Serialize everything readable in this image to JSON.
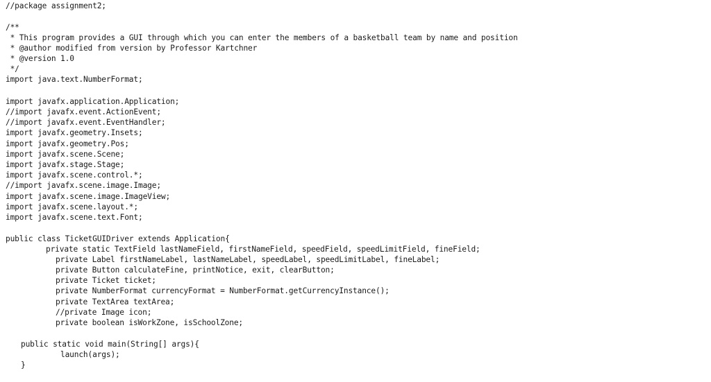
{
  "document": {
    "lines": [
      {
        "text": "//package assignment2;"
      },
      {
        "text": "/**"
      },
      {
        "text": " * This program provides a GUI through which you can enter the members of a basketball team by name and position"
      },
      {
        "text": " * @author modified from version by Professor Kartchner"
      },
      {
        "text": " * @version 1.0"
      },
      {
        "text": " */"
      },
      {
        "text": "import java.text.NumberFormat;"
      },
      {
        "text": "import javafx.application.Application;"
      },
      {
        "text": "//import javafx.event.ActionEvent;"
      },
      {
        "text": "//import javafx.event.EventHandler;"
      },
      {
        "text": "import javafx.geometry.Insets;"
      },
      {
        "text": "import javafx.geometry.Pos;"
      },
      {
        "text": "import javafx.scene.Scene;"
      },
      {
        "text": "import javafx.stage.Stage;"
      },
      {
        "text": "import javafx.scene.control.*;"
      },
      {
        "text": "//import javafx.scene.image.Image;"
      },
      {
        "text": "import javafx.scene.image.ImageView;"
      },
      {
        "text": "import javafx.scene.layout.*;"
      },
      {
        "text": "import javafx.scene.text.Font;"
      },
      {
        "text": "public class TicketGUIDriver extends Application{"
      },
      {
        "text": "private static TextField lastNameField, firstNameField, speedField, speedLimitField, fineField;"
      },
      {
        "text": "private Label firstNameLabel, lastNameLabel, speedLabel, speedLimitLabel, fineLabel;"
      },
      {
        "text": "private Button calculateFine, printNotice, exit, clearButton;"
      },
      {
        "text": "private Ticket ticket;"
      },
      {
        "text": "private NumberFormat currencyFormat = NumberFormat.getCurrencyInstance();"
      },
      {
        "text": "private TextArea textArea;"
      },
      {
        "text": "//private Image icon;"
      },
      {
        "text": "private boolean isWorkZone, isSchoolZone;"
      },
      {
        "text": "public static void main(String[] args){"
      },
      {
        "text": "launch(args);"
      },
      {
        "text": "}"
      }
    ]
  }
}
